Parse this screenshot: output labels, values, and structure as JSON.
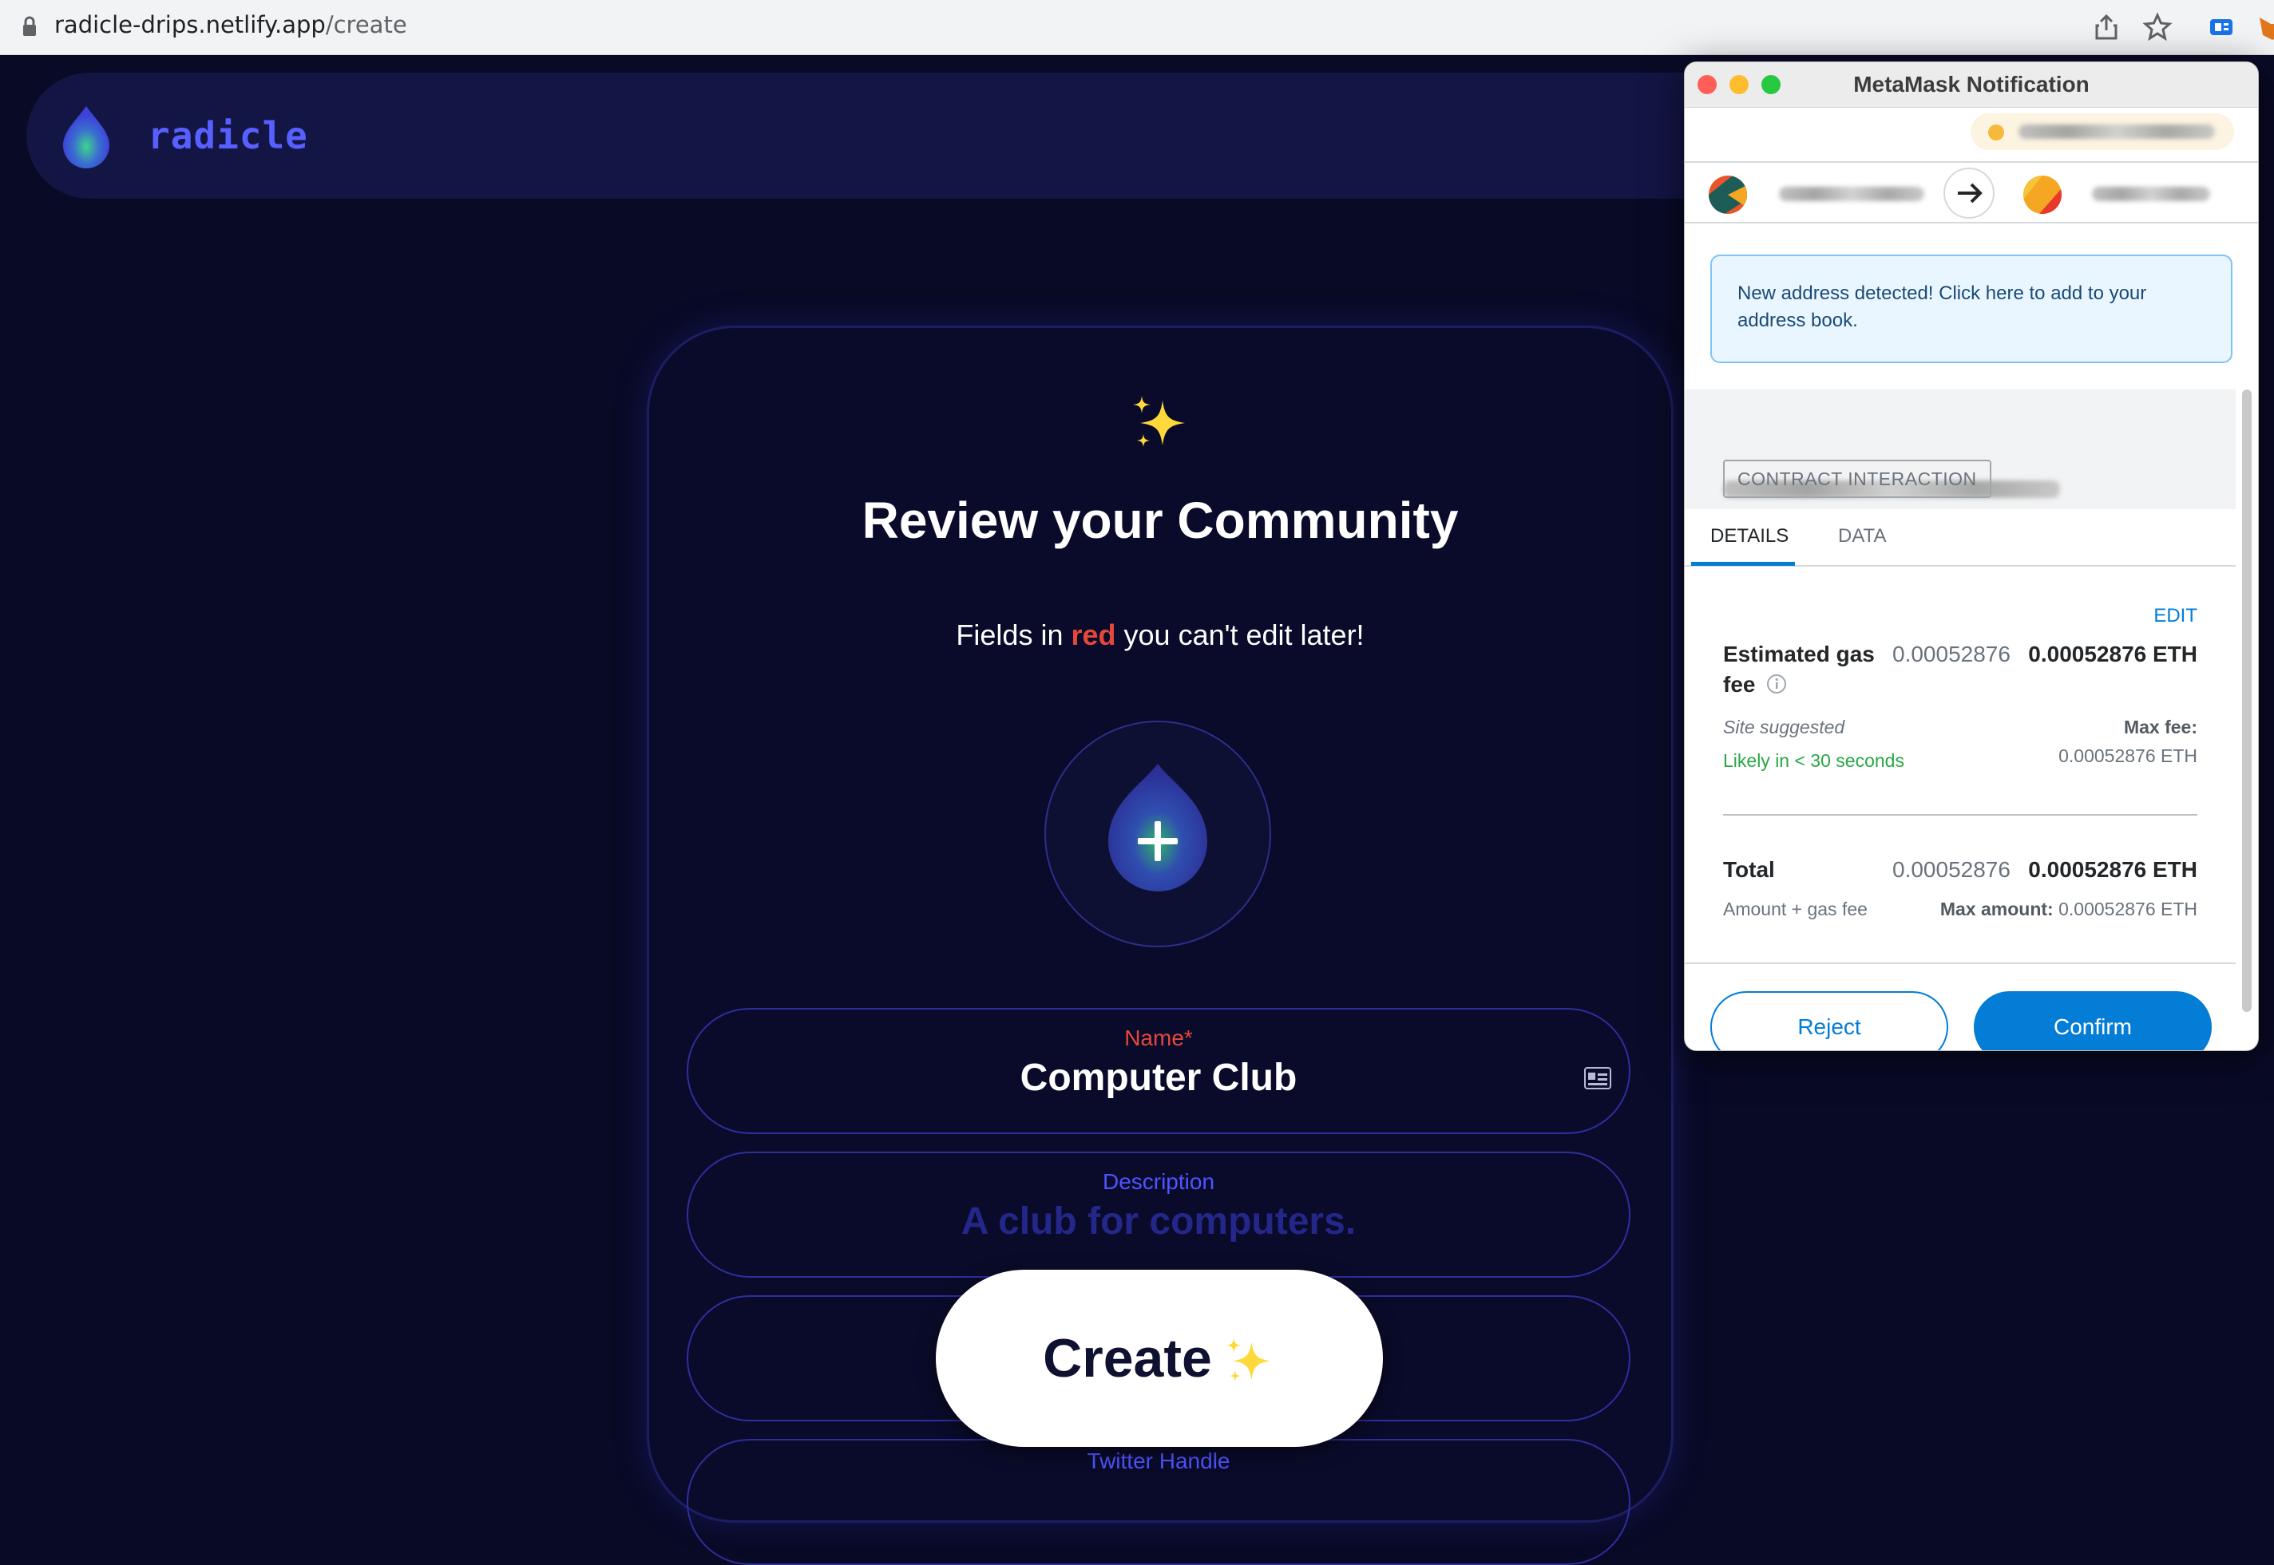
{
  "browser": {
    "url_host": "radicle-drips.netlify.app",
    "url_path": "/create"
  },
  "app": {
    "logo_text": "radicle",
    "title": "Review your Community",
    "subtitle_before": "Fields in ",
    "subtitle_red": "red",
    "subtitle_after": " you can't edit later!",
    "fields": [
      {
        "label": "Name*",
        "value": "Computer Club"
      },
      {
        "label": "Description",
        "value": "A club for computers."
      },
      {
        "label": "Twitter Handle",
        "value": ""
      }
    ],
    "create_label": "Create"
  },
  "metamask": {
    "window_title": "MetaMask Notification",
    "alert_text": "New address detected! Click here to add to your address book.",
    "contract_badge": "CONTRACT INTERACTION",
    "tabs": [
      "DETAILS",
      "DATA"
    ],
    "edit_label": "EDIT",
    "gas_label_line1": "Estimated gas",
    "gas_label_line2": "fee",
    "gas_value_light": "0.00052876",
    "gas_value_bold": "0.00052876 ETH",
    "site_suggested": "Site suggested",
    "likely": "Likely in < 30 seconds",
    "max_fee_label": "Max fee:",
    "max_fee_value": "0.00052876 ETH",
    "total_label": "Total",
    "total_value_light": "0.00052876",
    "total_value_bold": "0.00052876 ETH",
    "amount_gas": "Amount + gas fee",
    "max_amount_label": "Max amount:",
    "max_amount_value": "0.00052876 ETH",
    "reject_label": "Reject",
    "confirm_label": "Confirm"
  },
  "colors": {
    "background": "#090a26",
    "accent": "#5760ff",
    "red": "#e5483b",
    "metamask_blue": "#037dd6"
  }
}
